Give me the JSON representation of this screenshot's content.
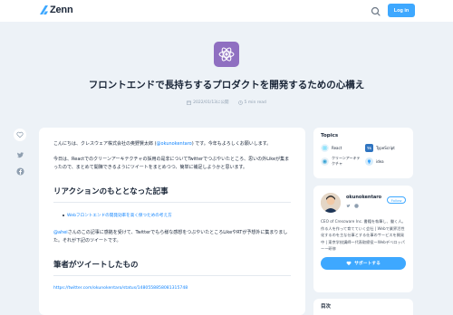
{
  "header": {
    "logo_text": "Zenn",
    "login_label": "Log in",
    "accent": "#3ea8ff"
  },
  "article": {
    "emoji_icon": "atom-icon",
    "title": "フロントエンドで長持ちするプロダクトを開発するための心構え",
    "published": "2022/01/13に公開",
    "read_time": "5 min read",
    "like_count": "",
    "intro": {
      "pre": "こんにちは、クレスウェア株式会社の奥野賢太郎 (",
      "link": "@okunokentaro",
      "post": ") です。今年もよろしくお願いします。"
    },
    "para2": "今日は、Reactでのクリーンアーキテクチャの採用の是非についてTwitterでつぶやいたところ、思いの外Likeが集まったので、まとめて開陳できるようにツイートをまとめつつ、簡単に補足しようかと思います。",
    "h2_1": "リアクションのもととなった記事",
    "list_item": "Webフロントエンドの開発効率を高く保つための考え方",
    "para3": {
      "link": "@ahei",
      "rest": "さんのこの記事に感銘を受けて、Twitterでもら様な感想をつぶやいたところLikeやRTが予想外に集まりました。それが下記のツイートです。"
    },
    "h2_2": "筆者がツイートしたもの",
    "tweet_url": "https://twitter.com/okunokentaro/status/1480558858081315748"
  },
  "topics": {
    "title": "Topics",
    "items": [
      {
        "label": "React",
        "icon": "react-icon",
        "color": "#e8f4fb"
      },
      {
        "label": "TypeScript",
        "icon": "typescript-icon",
        "color": "#2f74c0"
      },
      {
        "label": "クリーンアーキテクチャ",
        "icon": "architecture-icon",
        "color": "#e8f1f7"
      },
      {
        "label": "idea",
        "icon": "bulb-icon",
        "color": "#d7ecfa"
      }
    ]
  },
  "author": {
    "name": "okunokentaro",
    "follow_label": "Follow",
    "bio": "CEO of Crescware Inc. 書籍を執筆し、働く人。作る人を作って育てていく会社 | Webで業界活性化するのを主な仕事とする仕事のサービスを開発中 | 東京学校講師ー代表取締役ーWebデベロッパーー研修",
    "support_label": "サポートする"
  },
  "toc": {
    "title": "目次"
  }
}
